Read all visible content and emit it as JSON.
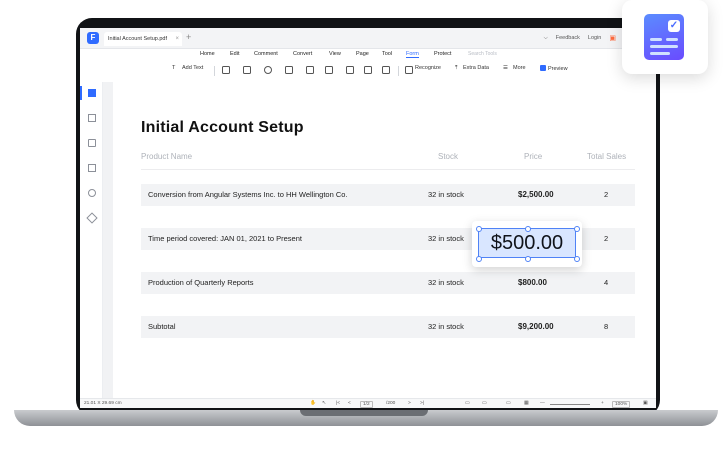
{
  "app": {
    "tab_title": "Initial Account Setup.pdf",
    "tab_close": "×",
    "new_tab": "+",
    "feedback": "Feedback",
    "login": "Login",
    "chevron": "⌵",
    "logo_letter": "F"
  },
  "menu": [
    "Home",
    "Edit",
    "Comment",
    "Convert",
    "View",
    "Page",
    "Tool",
    "Form",
    "Protect"
  ],
  "menu_active": "Form",
  "search_tools": "Search Tools",
  "toolbar": {
    "add_text": "Add Text",
    "recognize": "Recognize",
    "extra_data": "Extra Data",
    "more": "More",
    "preview": "Preview"
  },
  "document": {
    "title": "Initial Account Setup",
    "columns": [
      "Product Name",
      "Stock",
      "Price",
      "Total Sales"
    ],
    "rows": [
      {
        "name": "Conversion from Angular Systems Inc. to HH Wellington Co.",
        "stock": "32 in stock",
        "price": "$2,500.00",
        "sales": "2"
      },
      {
        "name": "Time period covered: JAN 01, 2021 to Present",
        "stock": "32 in stock",
        "price": "$500.00",
        "sales": "2"
      },
      {
        "name": "Production of Quarterly Reports",
        "stock": "32 in stock",
        "price": "$800.00",
        "sales": "4"
      },
      {
        "name": "Subtotal",
        "stock": "32 in stock",
        "price": "$9,200.00",
        "sales": "8"
      }
    ],
    "selected_value": "$500.00"
  },
  "statusbar": {
    "dimensions": "21.01 X 29.69 cm",
    "page": "1/2",
    "page_total": "/200",
    "zoom": "100%"
  },
  "colors": {
    "accent": "#2f6bff",
    "selection_fill": "#d9e6ff",
    "row_fill": "#f2f3f5"
  },
  "icons": [
    "hand-icon",
    "select-icon",
    "first-page-icon",
    "prev-page-icon",
    "next-page-icon",
    "last-page-icon",
    "bookmark-icon",
    "comment-icon",
    "attachment-icon",
    "search-icon",
    "layers-icon",
    "gift-icon"
  ]
}
